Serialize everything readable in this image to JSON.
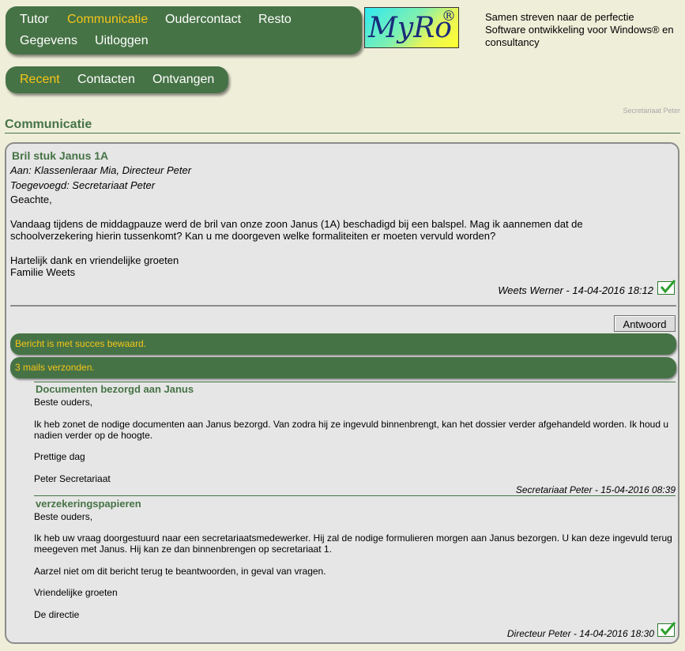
{
  "nav": {
    "main": [
      "Tutor",
      "Communicatie",
      "Oudercontact",
      "Resto",
      "Gegevens",
      "Uitloggen"
    ],
    "sub": [
      "Recent",
      "Contacten",
      "Ontvangen"
    ]
  },
  "logo": {
    "text": "MyRo",
    "reg": "®"
  },
  "tagline": [
    "Samen streven naar de perfectie",
    "Software ontwikkeling voor Windows® en consultancy"
  ],
  "user_corner": "Secretariaat Peter",
  "page_title": "Communicatie",
  "message": {
    "subject": "Bril stuk Janus 1A",
    "to": "Aan: Klassenleraar Mia, Directeur Peter",
    "added": "Toegevoegd: Secretariaat Peter",
    "greeting": "Geachte,",
    "para1_line1": "Vandaag tijdens de middagpauze werd de bril van onze zoon Janus (1A) beschadigd bij een balspel. Mag ik aannemen dat de",
    "para1_line2": "schoolverzekering hierin tussenkomt? Kan u me doorgeven welke formaliteiten er moeten vervuld worden?",
    "closing": "Hartelijk dank en vriendelijke groeten",
    "family": "Familie Weets",
    "signature": "Weets Werner - 14-04-2016 18:12"
  },
  "reply_button": "Antwoord",
  "notices": [
    "Bericht is met succes bewaard.",
    "3 mails verzonden."
  ],
  "replies": [
    {
      "subject": "Documenten bezorgd aan Janus",
      "greeting": "Beste ouders,",
      "line1": "Ik heb zonet de nodige documenten aan Janus bezorgd. Van zodra hij ze ingevuld binnenbrengt, kan het dossier verder afgehandeld worden. Ik houd u",
      "line2": "nadien verder op de hoogte.",
      "closing": "Prettige dag",
      "name": "Peter Secretariaat",
      "signature": "Secretariaat Peter - 15-04-2016 08:39"
    },
    {
      "subject": "verzekeringspapieren",
      "greeting": "Beste ouders,",
      "line1": "Ik heb uw vraag doorgestuurd naar een secretariaatsmedewerker. Hij zal de nodige formulieren morgen aan Janus bezorgen. U kan deze ingevuld terug",
      "line2": "meegeven met Janus. Hij kan ze dan binnenbrengen op secretariaat 1.",
      "para2": "Aarzel niet om dit bericht terug te beantwoorden, in geval van vragen.",
      "closing": "Vriendelijke groeten",
      "name": "De directie",
      "signature": "Directeur Peter - 14-04-2016 18:30"
    }
  ],
  "colors": {
    "nav_green": "#467346",
    "active_yellow": "#f5c518",
    "background": "#efeed9"
  },
  "icons": [
    "check-icon"
  ]
}
